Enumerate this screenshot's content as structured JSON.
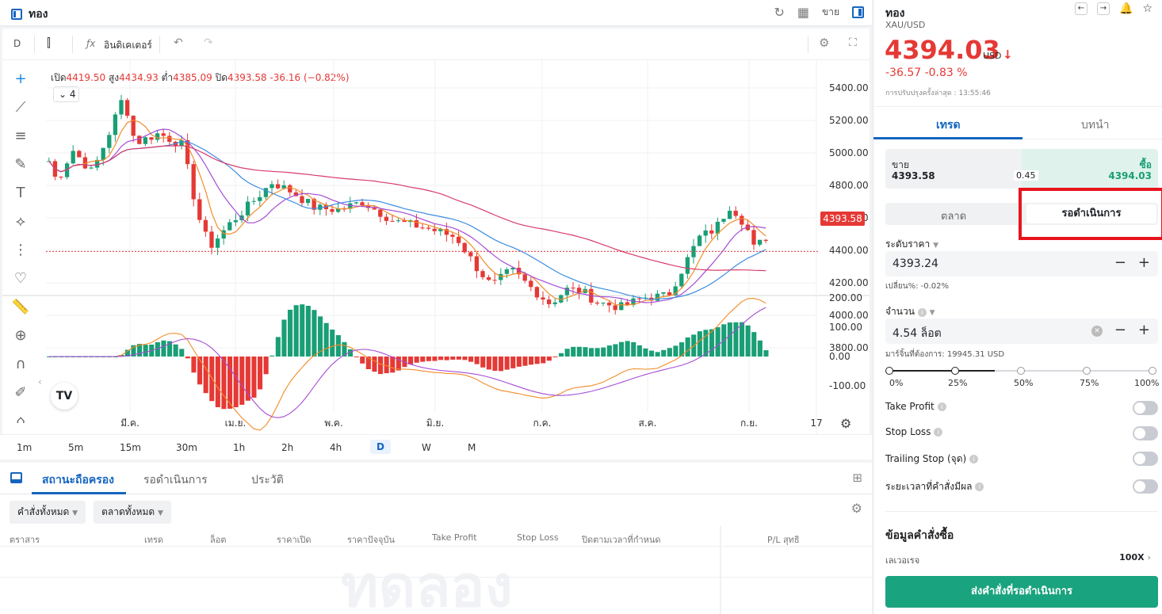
{
  "header": {
    "symbol_name": "ทอง",
    "sell_label": "ขาย"
  },
  "chart_toolbar": {
    "interval": "D",
    "indicators_label": "อินดิเคเตอร์"
  },
  "legend": {
    "open_label": "เปิด",
    "open": "4419.50",
    "high_label": "สูง",
    "high": "4434.93",
    "low_label": "ต่ำ",
    "low": "4385.09",
    "close_label": "ปิด",
    "close": "4393.58",
    "change": "-36.16 (−0.82%)",
    "indicator_count": "4"
  },
  "current_price_tag": "4393.58",
  "price_axis": [
    "5400.00",
    "5200.00",
    "5000.00",
    "4800.00",
    "4600.00",
    "4400.00",
    "4200.00",
    "4000.00",
    "3800.00"
  ],
  "macd_axis": [
    "200.00",
    "100.00",
    "0.00",
    "-100.00"
  ],
  "time_axis": [
    "มี.ค.",
    "เม.ย.",
    "พ.ค.",
    "มิ.ย.",
    "ก.ค.",
    "ส.ค.",
    "ก.ย.",
    "17"
  ],
  "timeframes": [
    "1m",
    "5m",
    "15m",
    "30m",
    "1h",
    "2h",
    "4h",
    "D",
    "W",
    "M"
  ],
  "selected_timeframe": "D",
  "bottom": {
    "tabs": [
      "สถานะถือครอง",
      "รอดำเนินการ",
      "ประวัติ"
    ],
    "filters": [
      "คำสั่งทั้งหมด",
      "ตลาดทั้งหมด"
    ],
    "columns": [
      "ตราสาร",
      "เทรด",
      "ล็อต",
      "ราคาเปิด",
      "ราคาปัจจุบัน",
      "Take Profit",
      "Stop Loss",
      "ปิดตามเวลาที่กำหนด",
      "P/L สุทธิ"
    ],
    "watermark": "ทดลอง"
  },
  "panel": {
    "title": "ทอง",
    "subtitle": "XAU/USD",
    "price": "4394.03",
    "currency": "USD",
    "change": "-36.57  -0.83 %",
    "updated": "การปรับปรุงครั้งล่าสุด : 13:55:46",
    "tabs": [
      "เทรด",
      "บทนำ"
    ],
    "sell_label": "ขาย",
    "sell_price": "4393.58",
    "buy_label": "ซื้อ",
    "buy_price": "4394.03",
    "spread": "0.45",
    "order_types": [
      "ตลาด",
      "รอดำเนินการ"
    ],
    "price_level_label": "ระดับราคา",
    "price_level_value": "4393.24",
    "change_pct": "เปลี่ยน%: -0.02%",
    "volume_label": "จำนวน",
    "volume_value": "4.54  ล็อต",
    "margin": "มาร์จิ้นที่ต้องการ:  19945.31 USD",
    "slider_pcts": [
      "0%",
      "25%",
      "50%",
      "75%",
      "100%"
    ],
    "slider_value_fraction": 0.4,
    "toggles": [
      "Take Profit",
      "Stop Loss",
      "Trailing Stop (จุด)",
      "ระยะเวลาที่คำสั่งมีผล"
    ],
    "order_info_title": "ข้อมูลคำสั่งซื้อ",
    "leverage_label": "เลเวอเรจ",
    "leverage_value": "100X",
    "submit_label": "ส่งคำสั่งที่รอดำเนินการ"
  },
  "colors": {
    "accent": "#1565c0",
    "down": "#e53935",
    "up": "#1a9e75",
    "highlight": "#e8141c"
  }
}
